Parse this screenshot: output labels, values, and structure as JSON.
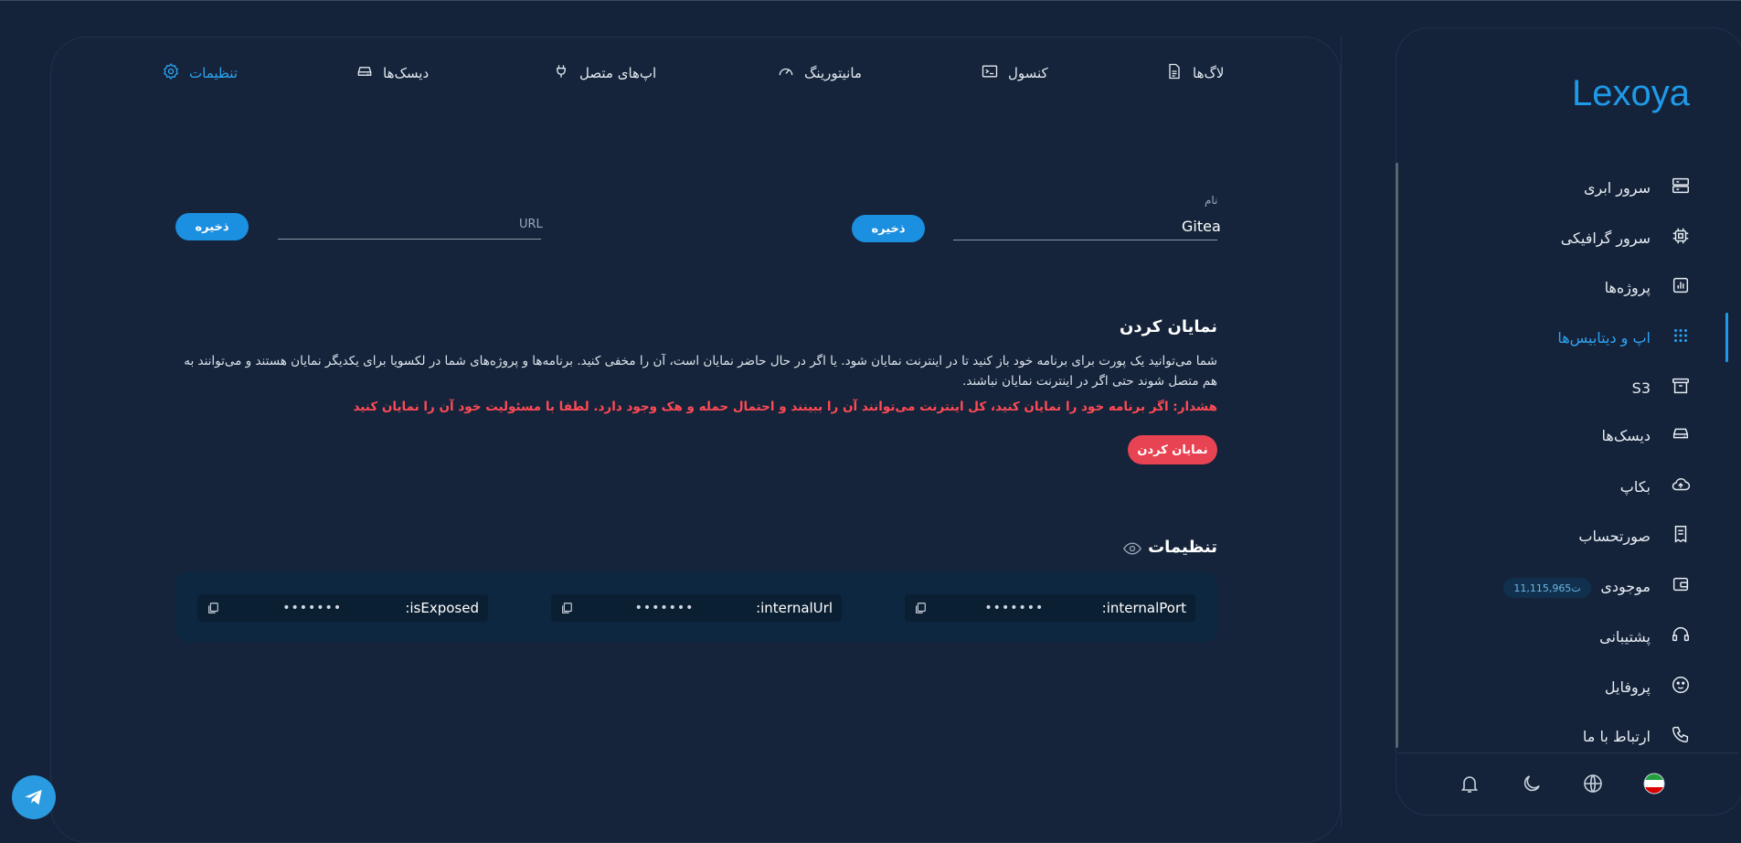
{
  "tabs": [
    {
      "label": "لاگ‌ها",
      "icon": "file-text-icon"
    },
    {
      "label": "کنسول",
      "icon": "terminal-icon"
    },
    {
      "label": "مانیتورینگ",
      "icon": "gauge-icon"
    },
    {
      "label": "اپ‌های متصل",
      "icon": "plug-icon"
    },
    {
      "label": "دیسک‌ها",
      "icon": "disk-icon"
    },
    {
      "label": "تنظیمات",
      "icon": "gear-icon"
    }
  ],
  "name_field": {
    "label": "نام",
    "value": "Gitea",
    "save_label": "ذخیره"
  },
  "url_field": {
    "placeholder": "URL",
    "save_label": "ذخیره"
  },
  "expose": {
    "title": "نمایان کردن",
    "description": "شما می‌توانید یک پورت برای برنامه خود باز کنید تا در اینترنت نمایان شود. یا اگر در حال حاضر نمایان است، آن را مخفی کنید. برنامه‌ها و پروژه‌های شما در لکسویا برای یکدیگر نمایان هستند و می‌توانند به هم متصل شوند حتی اگر در اینترنت نمایان نباشند.",
    "warning": "هشدار: اگر برنامه خود را نمایان کنید، کل اینترنت می‌توانند آن را ببینند و احتمال حمله و هک وجود دارد. لطفا با مسئولیت خود آن را نمایان کنید",
    "button_label": "نمایان کردن"
  },
  "settings": {
    "title": "تنظیمات",
    "items": [
      {
        "key": "internalPort:",
        "value": "•••••••"
      },
      {
        "key": "internalUrl:",
        "value": "•••••••"
      },
      {
        "key": "isExposed:",
        "value": "•••••••"
      }
    ]
  },
  "sidebar": {
    "logo": "Lexoya",
    "items": [
      {
        "label": "سرور ابری",
        "icon": "server-icon"
      },
      {
        "label": "سرور گرافیکی",
        "icon": "cpu-icon"
      },
      {
        "label": "پروژه‌ها",
        "icon": "chart-icon"
      },
      {
        "label": "اپ و دیتابیس‌ها",
        "icon": "grid-icon"
      },
      {
        "label": "S3",
        "icon": "archive-icon"
      },
      {
        "label": "دیسک‌ها",
        "icon": "disk-icon"
      },
      {
        "label": "بکاپ",
        "icon": "cloud-upload-icon"
      },
      {
        "label": "صورتحساب",
        "icon": "receipt-icon"
      },
      {
        "label": "موجودی",
        "icon": "wallet-icon"
      },
      {
        "label": "پشتیبانی",
        "icon": "headset-icon"
      },
      {
        "label": "پروفایل",
        "icon": "profile-icon"
      },
      {
        "label": "ارتباط با ما",
        "icon": "phone-icon"
      }
    ],
    "balance": "11,115,965ت",
    "active_index": 3
  },
  "colors": {
    "accent": "#1e9ae8",
    "danger": "#e84352",
    "background": "#15233a"
  }
}
